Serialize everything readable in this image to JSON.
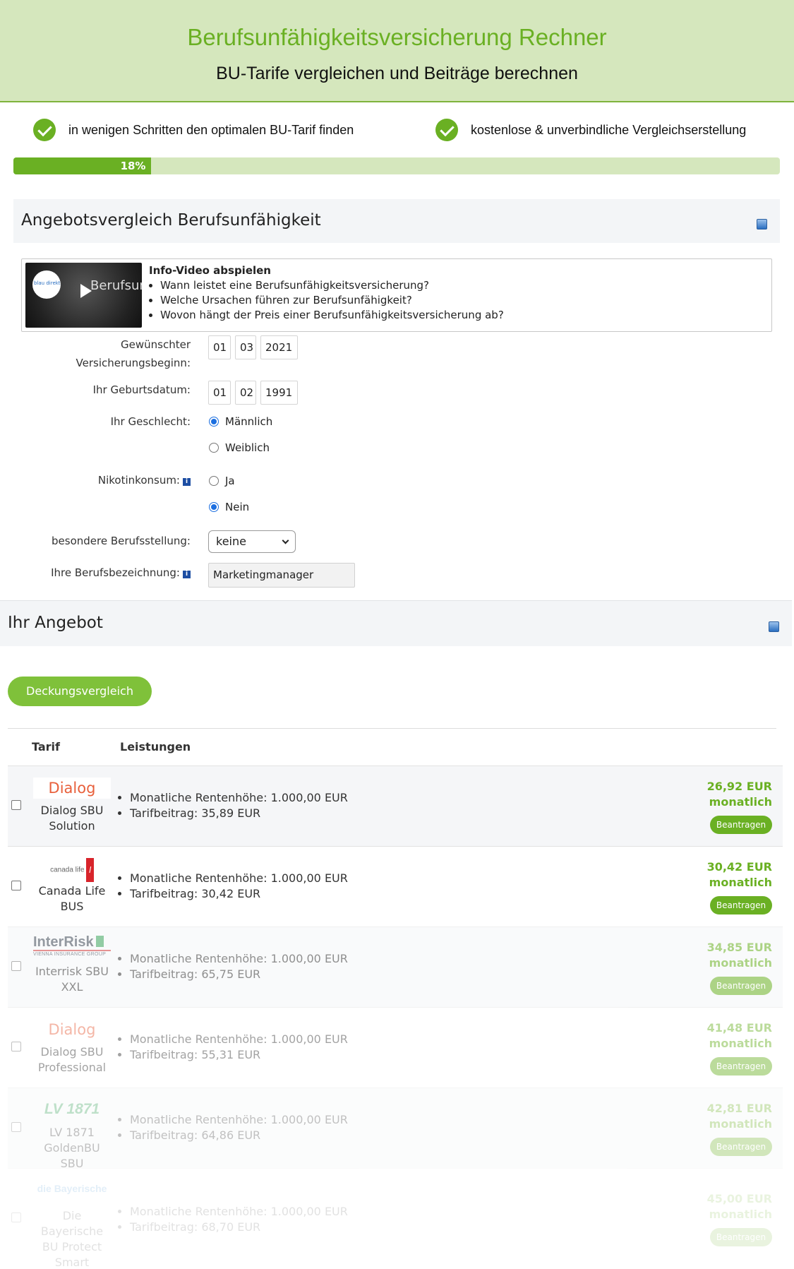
{
  "header": {
    "title": "Berufsunfähigkeitsversicherung Rechner",
    "subtitle": "BU-Tarife vergleichen und Beiträge berechnen"
  },
  "benefits": [
    "in wenigen Schritten den optimalen BU-Tarif finden",
    "kostenlose & unverbindliche Vergleichserstellung"
  ],
  "progress": {
    "percent": 18,
    "label": "18%"
  },
  "section1": {
    "title": "Angebotsvergleich Berufsunfähigkeit"
  },
  "video": {
    "thumb_caption": "Berufsun...",
    "logo_text": "blau direkt",
    "title": "Info-Video abspielen",
    "items": [
      "Wann leistet eine Berufsunfähigkeitsversicherung?",
      "Welche Ursachen führen zur Berufsunfähigkeit?",
      "Wovon hängt der Preis einer Berufsunfähigkeitsversicherung ab?"
    ]
  },
  "form": {
    "start_label_line1": "Gewünschter",
    "start_label_line2": "Versicherungsbeginn:",
    "start_day": "01",
    "start_month": "03",
    "start_year": "2021",
    "birth_label": "Ihr Geburtsdatum:",
    "birth_day": "01",
    "birth_month": "02",
    "birth_year": "1991",
    "gender_label": "Ihr Geschlecht:",
    "gender_options": [
      "Männlich",
      "Weiblich"
    ],
    "gender_selected": "Männlich",
    "nicotine_label": "Nikotinkonsum:",
    "nicotine_options": [
      "Ja",
      "Nein"
    ],
    "nicotine_selected": "Nein",
    "job_position_label": "besondere Berufsstellung:",
    "job_position_value": "keine",
    "job_title_label": "Ihre Berufsbezeichnung:",
    "job_title_value": "Marketingmanager",
    "info_icon": "i"
  },
  "section2": {
    "title": "Ihr Angebot"
  },
  "compare_button": "Deckungsvergleich",
  "table": {
    "headers": [
      "Tarif",
      "Leistungen"
    ],
    "apply_label": "Beantragen",
    "rows": [
      {
        "logo": "Dialog",
        "name": "Dialog SBU Solution",
        "rente": "Monatliche Rentenhöhe: 1.000,00 EUR",
        "beitrag": "Tarifbeitrag: 35,89 EUR",
        "price": "26,92 EUR",
        "period": "monatlich"
      },
      {
        "logo": "canada life",
        "name": "Canada Life BUS",
        "rente": "Monatliche Rentenhöhe: 1.000,00 EUR",
        "beitrag": "Tarifbeitrag: 30,42 EUR",
        "price": "30,42 EUR",
        "period": "monatlich"
      },
      {
        "logo": "InterRisk",
        "logo_sub": "VIENNA INSURANCE GROUP",
        "name": "Interrisk SBU XXL",
        "rente": "Monatliche Rentenhöhe: 1.000,00 EUR",
        "beitrag": "Tarifbeitrag: 65,75 EUR",
        "price": "34,85 EUR",
        "period": "monatlich"
      },
      {
        "logo": "Dialog",
        "name": "Dialog SBU Professional",
        "rente": "Monatliche Rentenhöhe: 1.000,00 EUR",
        "beitrag": "Tarifbeitrag: 55,31 EUR",
        "price": "41,48 EUR",
        "period": "monatlich"
      },
      {
        "logo": "LV 1871",
        "name": "LV 1871 GoldenBU SBU",
        "rente": "Monatliche Rentenhöhe: 1.000,00 EUR",
        "beitrag": "Tarifbeitrag: 64,86 EUR",
        "price": "42,81 EUR",
        "period": "monatlich"
      },
      {
        "logo": "die Bayerische",
        "name": "Die Bayerische BU Protect Smart",
        "rente": "Monatliche Rentenhöhe: 1.000,00 EUR",
        "beitrag": "Tarifbeitrag: 68,70 EUR",
        "price": "45,00 EUR",
        "period": "monatlich"
      }
    ]
  },
  "colors": {
    "brand_green": "#6ab023",
    "header_bg": "#d5e7bd",
    "compare_button": "#7fc13a",
    "info_blue": "#1d4ea3"
  },
  "icons": {
    "benefit": "check-circle-icon",
    "section": "section-toggle-icon",
    "video": "play-icon",
    "info": "info-icon"
  }
}
